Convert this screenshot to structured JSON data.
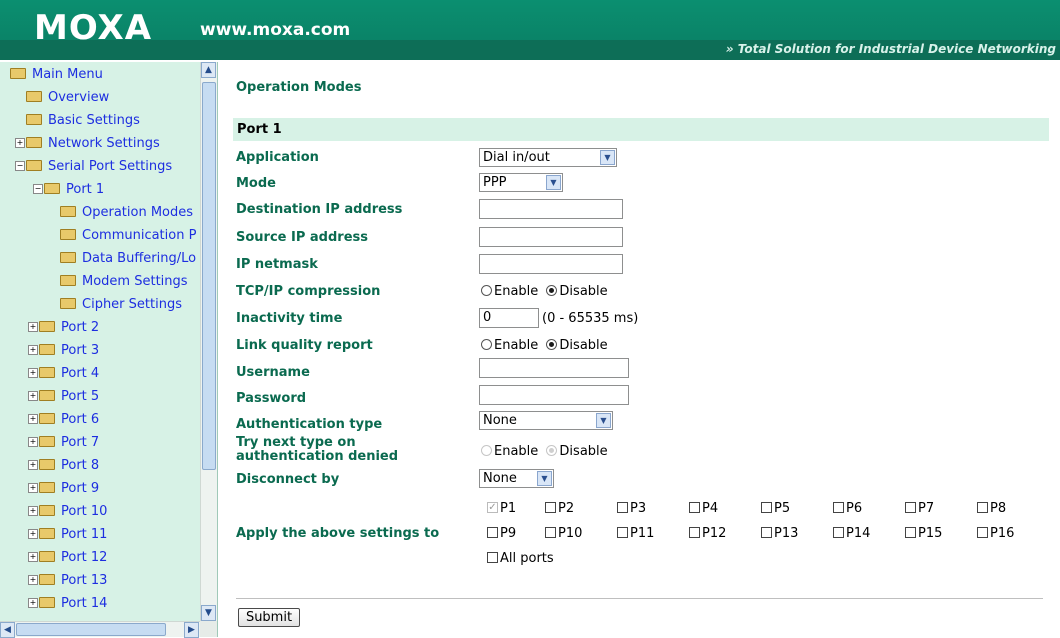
{
  "header": {
    "logo": "MOXA",
    "url": "www.moxa.com",
    "tagline": "» Total Solution for Industrial Device Networking"
  },
  "sidebar": {
    "items": [
      {
        "label": "Main Menu",
        "open": true
      },
      {
        "label": "Overview"
      },
      {
        "label": "Basic Settings"
      },
      {
        "label": "Network Settings",
        "expandable": true
      },
      {
        "label": "Serial Port Settings",
        "expandable": true,
        "open": true
      },
      {
        "label": "Port 1",
        "expandable": true,
        "open": true
      },
      {
        "label": "Operation Modes"
      },
      {
        "label": "Communication P"
      },
      {
        "label": "Data Buffering/Lo"
      },
      {
        "label": "Modem Settings"
      },
      {
        "label": "Cipher Settings"
      },
      {
        "label": "Port 2"
      },
      {
        "label": "Port 3"
      },
      {
        "label": "Port 4"
      },
      {
        "label": "Port 5"
      },
      {
        "label": "Port 6"
      },
      {
        "label": "Port 7"
      },
      {
        "label": "Port 8"
      },
      {
        "label": "Port 9"
      },
      {
        "label": "Port 10"
      },
      {
        "label": "Port 11"
      },
      {
        "label": "Port 12"
      },
      {
        "label": "Port 13"
      },
      {
        "label": "Port 14"
      }
    ]
  },
  "main": {
    "title": "Operation Modes",
    "port_header": "Port 1",
    "fields": {
      "application": {
        "label": "Application",
        "value": "Dial in/out"
      },
      "mode": {
        "label": "Mode",
        "value": "PPP"
      },
      "dest_ip": {
        "label": "Destination IP address",
        "value": ""
      },
      "src_ip": {
        "label": "Source IP address",
        "value": ""
      },
      "netmask": {
        "label": "IP netmask",
        "value": ""
      },
      "tcpip_comp": {
        "label": "TCP/IP compression",
        "opt1": "Enable",
        "opt2": "Disable",
        "selected": "Disable"
      },
      "inactivity": {
        "label": "Inactivity time",
        "value": "0",
        "suffix": "(0 - 65535 ms)"
      },
      "lqr": {
        "label": "Link quality report",
        "opt1": "Enable",
        "opt2": "Disable",
        "selected": "Disable"
      },
      "username": {
        "label": "Username",
        "value": ""
      },
      "password": {
        "label": "Password",
        "value": ""
      },
      "auth_type": {
        "label": "Authentication type",
        "value": "None"
      },
      "try_next": {
        "label": "Try next type on authentication denied",
        "opt1": "Enable",
        "opt2": "Disable",
        "selected": "Disable",
        "disabled": true
      },
      "disconnect": {
        "label": "Disconnect by",
        "value": "None"
      }
    },
    "apply": {
      "label": "Apply the above settings to",
      "ports": [
        "P1",
        "P2",
        "P3",
        "P4",
        "P5",
        "P6",
        "P7",
        "P8",
        "P9",
        "P10",
        "P11",
        "P12",
        "P13",
        "P14",
        "P15",
        "P16"
      ],
      "checked": [
        "P1"
      ],
      "all_ports": "All ports"
    },
    "submit": "Submit"
  },
  "colors": {
    "header_green": "#0a7d63",
    "label_green": "#0a6a4f",
    "sidebar_bg": "#d7f2e6",
    "link_blue": "#1d2ee0"
  }
}
